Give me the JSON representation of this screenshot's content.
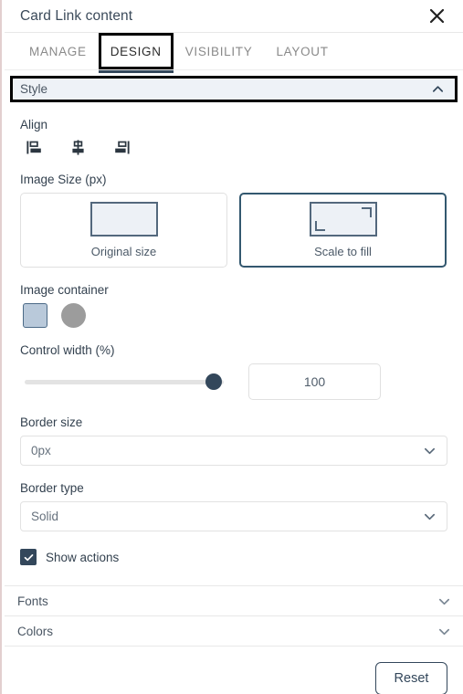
{
  "panel": {
    "title": "Card Link content",
    "close_icon": "close-icon"
  },
  "tabs": [
    {
      "label": "MANAGE",
      "active": false
    },
    {
      "label": "DESIGN",
      "active": true
    },
    {
      "label": "VISIBILITY",
      "active": false
    },
    {
      "label": "LAYOUT",
      "active": false
    }
  ],
  "sections": {
    "style": {
      "label": "Style",
      "expanded": true,
      "chevron": "chevron-up-icon"
    },
    "fonts": {
      "label": "Fonts",
      "expanded": false,
      "chevron": "chevron-down-icon"
    },
    "colors": {
      "label": "Colors",
      "expanded": false,
      "chevron": "chevron-down-icon"
    }
  },
  "align": {
    "label": "Align",
    "options": [
      {
        "name": "align-left-icon",
        "value": "left"
      },
      {
        "name": "align-center-icon",
        "value": "center"
      },
      {
        "name": "align-right-icon",
        "value": "right"
      }
    ]
  },
  "image_size": {
    "label": "Image Size (px)",
    "options": [
      {
        "caption": "Original size",
        "selected": false,
        "icon": "rectangle-icon"
      },
      {
        "caption": "Scale to fill",
        "selected": true,
        "icon": "scale-to-fill-icon"
      }
    ]
  },
  "image_container": {
    "label": "Image container",
    "options": [
      {
        "shape": "square",
        "selected": true,
        "color": "#b9c9da"
      },
      {
        "shape": "circle",
        "selected": false,
        "color": "#9c9c9c"
      }
    ]
  },
  "control_width": {
    "label": "Control width (%)",
    "value": "100",
    "min": 0,
    "max": 100,
    "percent": 100
  },
  "border_size": {
    "label": "Border size",
    "value": "0px"
  },
  "border_type": {
    "label": "Border type",
    "value": "Solid"
  },
  "show_actions": {
    "label": "Show actions",
    "checked": true
  },
  "footer": {
    "reset_label": "Reset"
  },
  "colors": {
    "accent": "#33475b",
    "selected_border": "#33586f",
    "panel_bg": "#ffffff",
    "section_bg": "#eef2f7",
    "left_edge": "#e2cfcf"
  }
}
